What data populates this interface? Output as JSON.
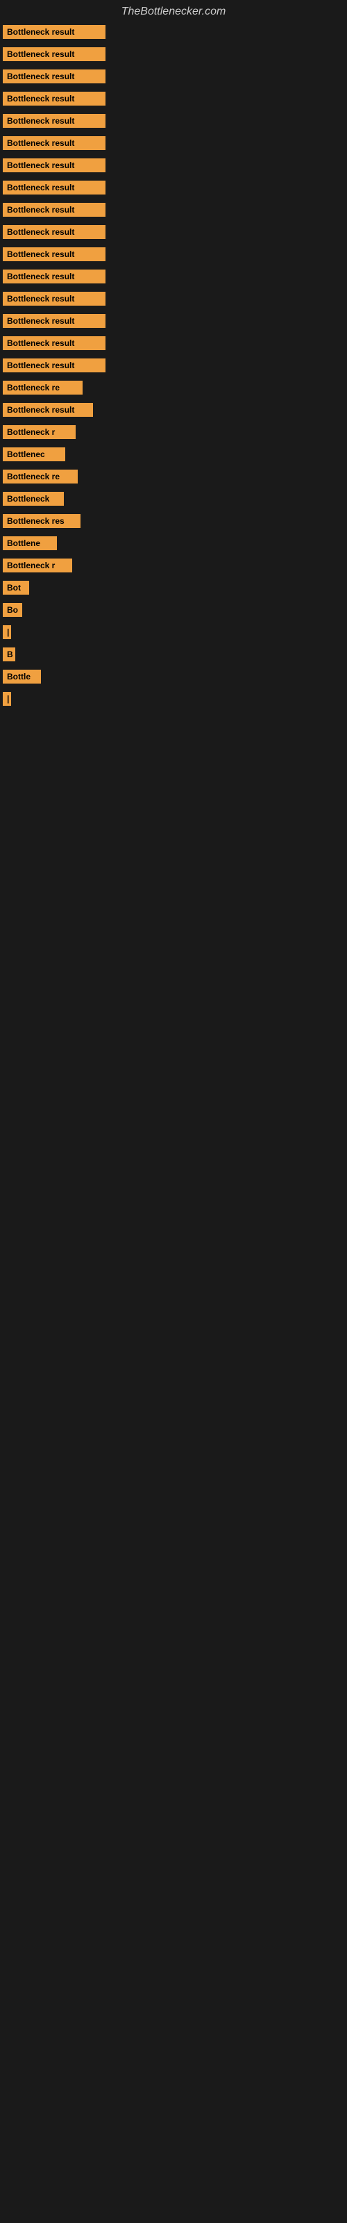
{
  "site": {
    "title": "TheBottlenecker.com"
  },
  "bars": [
    {
      "label": "Bottleneck result",
      "width": 148
    },
    {
      "label": "Bottleneck result",
      "width": 148
    },
    {
      "label": "Bottleneck result",
      "width": 148
    },
    {
      "label": "Bottleneck result",
      "width": 148
    },
    {
      "label": "Bottleneck result",
      "width": 148
    },
    {
      "label": "Bottleneck result",
      "width": 148
    },
    {
      "label": "Bottleneck result",
      "width": 148
    },
    {
      "label": "Bottleneck result",
      "width": 148
    },
    {
      "label": "Bottleneck result",
      "width": 148
    },
    {
      "label": "Bottleneck result",
      "width": 148
    },
    {
      "label": "Bottleneck result",
      "width": 148
    },
    {
      "label": "Bottleneck result",
      "width": 148
    },
    {
      "label": "Bottleneck result",
      "width": 148
    },
    {
      "label": "Bottleneck result",
      "width": 148
    },
    {
      "label": "Bottleneck result",
      "width": 148
    },
    {
      "label": "Bottleneck result",
      "width": 148
    },
    {
      "label": "Bottleneck re",
      "width": 115
    },
    {
      "label": "Bottleneck result",
      "width": 130
    },
    {
      "label": "Bottleneck r",
      "width": 105
    },
    {
      "label": "Bottlenec",
      "width": 90
    },
    {
      "label": "Bottleneck re",
      "width": 108
    },
    {
      "label": "Bottleneck",
      "width": 88
    },
    {
      "label": "Bottleneck res",
      "width": 112
    },
    {
      "label": "Bottlene",
      "width": 78
    },
    {
      "label": "Bottleneck r",
      "width": 100
    },
    {
      "label": "Bot",
      "width": 38
    },
    {
      "label": "Bo",
      "width": 28
    },
    {
      "label": "|",
      "width": 8
    },
    {
      "label": "B",
      "width": 18
    },
    {
      "label": "Bottle",
      "width": 55
    },
    {
      "label": "|",
      "width": 5
    }
  ]
}
